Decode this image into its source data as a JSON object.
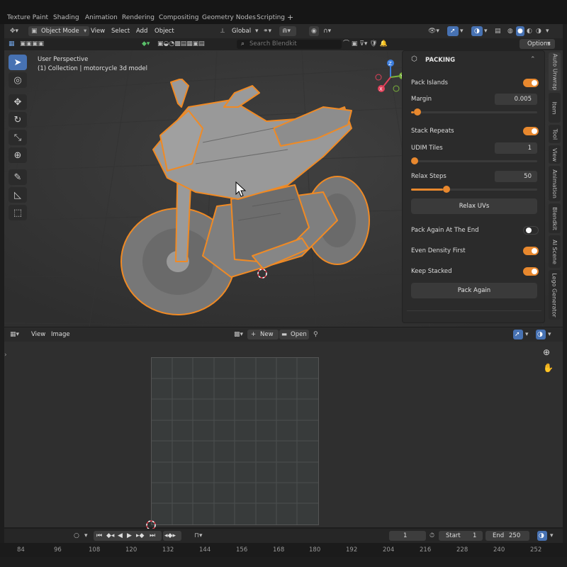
{
  "workspace_tabs": [
    "Texture Paint",
    "Shading",
    "Animation",
    "Rendering",
    "Compositing",
    "Geometry Nodes",
    "Scripting",
    "+"
  ],
  "viewport_header": {
    "mode": "Object Mode",
    "menus": [
      "View",
      "Select",
      "Add",
      "Object"
    ],
    "orientation": "Global",
    "options_label": "Options"
  },
  "search": {
    "placeholder": "Search Blendkit"
  },
  "viewport": {
    "perspective_label": "User Perspective",
    "collection_label": "(1) Collection | motorcycle 3d model"
  },
  "gizmo_axes": {
    "x": "X",
    "y": "Y",
    "z": "Z"
  },
  "panel": {
    "title": "PACKING",
    "pack_islands": {
      "label": "Pack Islands",
      "on": true
    },
    "margin": {
      "label": "Margin",
      "value": "0.005",
      "level": 0.02
    },
    "stack_repeats": {
      "label": "Stack Repeats",
      "on": true
    },
    "udim_tiles": {
      "label": "UDIM Tiles",
      "value": "1",
      "level": 0.0
    },
    "relax_steps": {
      "label": "Relax Steps",
      "value": "50",
      "level": 0.25
    },
    "relax_button": "Relax UVs",
    "pack_again_end": {
      "label": "Pack Again At The End",
      "on": false
    },
    "even_density": {
      "label": "Even Density First",
      "on": true
    },
    "keep_stacked": {
      "label": "Keep Stacked",
      "on": true
    },
    "pack_again_button": "Pack Again"
  },
  "side_tabs": [
    "Auto Unwrap",
    "Item",
    "Tool",
    "View",
    "Animation",
    "Blendkit",
    "AI Scene",
    "Lego Generator"
  ],
  "uv_header": {
    "menus": [
      "View",
      "Image"
    ],
    "new_label": "New",
    "open_label": "Open"
  },
  "timeline": {
    "current_frame": "1",
    "start_label": "Start",
    "start_value": "1",
    "end_label": "End",
    "end_value": "250"
  },
  "frame_numbers": [
    "84",
    "96",
    "108",
    "120",
    "132",
    "144",
    "156",
    "168",
    "180",
    "192",
    "204",
    "216",
    "228",
    "240",
    "252"
  ],
  "colors": {
    "accent": "#e8882e",
    "active_tool": "#4772b3",
    "selection_outline": "#f08a24"
  }
}
